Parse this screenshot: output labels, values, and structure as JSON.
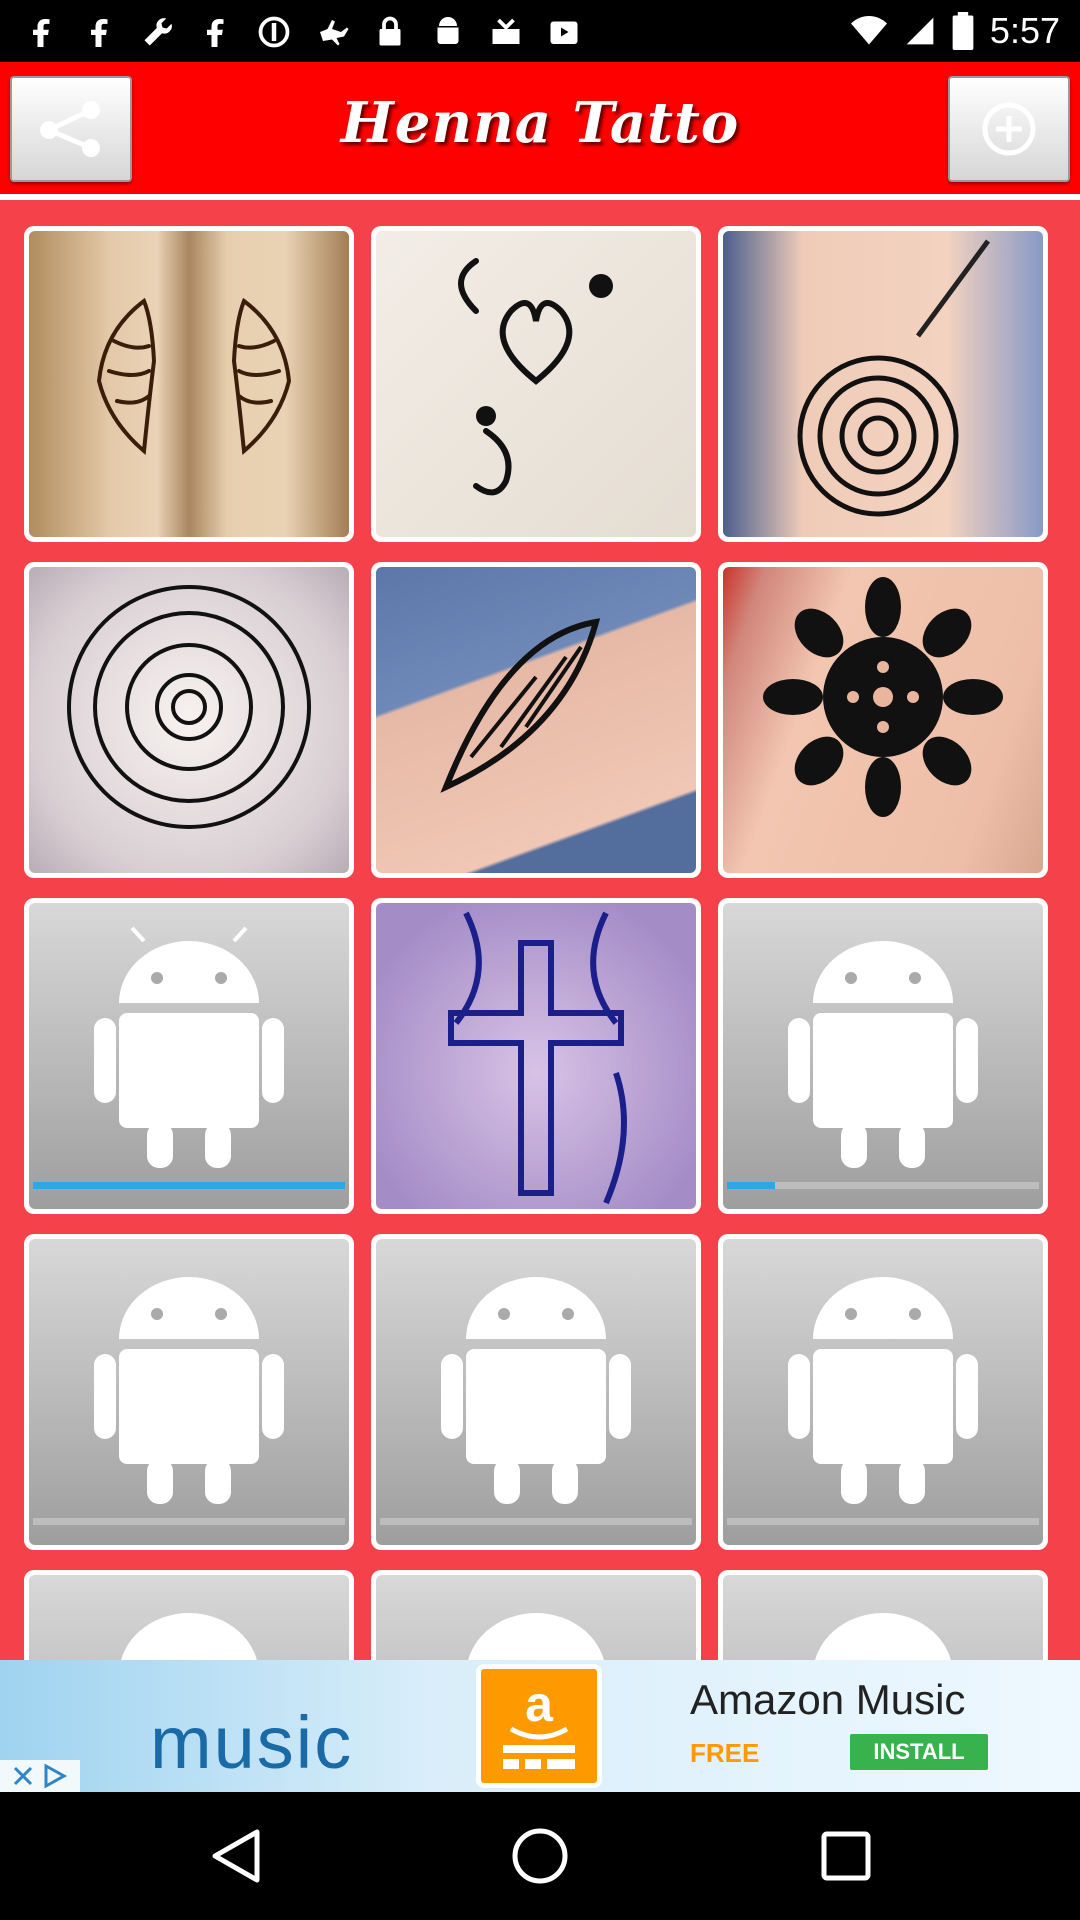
{
  "status_bar": {
    "time": "5:57",
    "icons": [
      "facebook-icon",
      "facebook-icon",
      "wrench-icon",
      "facebook-icon",
      "blocked-icon",
      "fake-gps-icon",
      "lock-icon",
      "android-icon",
      "check-box-icon",
      "play-store-icon",
      "wifi-icon",
      "signal-icon",
      "battery-icon"
    ]
  },
  "header": {
    "title": "Henna Tatto",
    "share_icon": "share-icon",
    "add_icon": "add-circle-icon"
  },
  "gallery": {
    "items": [
      {
        "type": "photo",
        "subject": "winged henna on two wrists"
      },
      {
        "type": "photo",
        "subject": "heart and swirl henna"
      },
      {
        "type": "photo",
        "subject": "mandala flower henna with applicator cone"
      },
      {
        "type": "photo",
        "subject": "mandala flower henna"
      },
      {
        "type": "photo",
        "subject": "leaf henna on wrist"
      },
      {
        "type": "photo",
        "subject": "black flower henna on shoulder"
      },
      {
        "type": "loading",
        "progress": 1.0
      },
      {
        "type": "photo",
        "subject": "blue cross henna"
      },
      {
        "type": "loading",
        "progress": 0.15
      },
      {
        "type": "loading",
        "progress": 0
      },
      {
        "type": "loading",
        "progress": 0
      },
      {
        "type": "loading",
        "progress": 0
      },
      {
        "type": "loading",
        "progress": 0
      },
      {
        "type": "loading",
        "progress": 0
      },
      {
        "type": "loading",
        "progress": 0
      }
    ]
  },
  "ad": {
    "left_text": "music",
    "title": "Amazon Music",
    "free_label": "FREE",
    "install_label": "INSTALL",
    "brand_color": "#ff9900"
  },
  "colors": {
    "toolbar": "#ff0000",
    "background": "#f5424a",
    "progress": "#2ea8e0"
  },
  "nav": {
    "back_icon": "back-icon",
    "home_icon": "home-icon",
    "recents_icon": "recents-icon"
  }
}
